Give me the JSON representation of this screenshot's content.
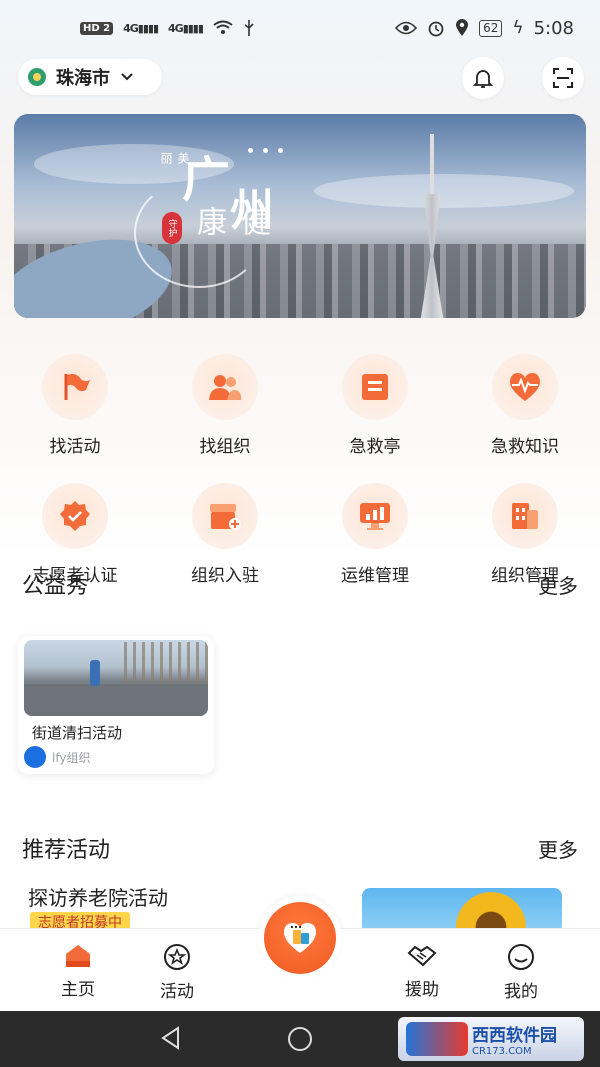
{
  "status_bar": {
    "hd_badge": "HD 2",
    "signal_1": "4G",
    "signal_2": "4G",
    "battery": "62",
    "time": "5:08"
  },
  "header": {
    "city": "珠海市"
  },
  "banner": {
    "small_text": "美丽",
    "title_char_1": "广",
    "title_char_2": "州",
    "subtitle": "健康",
    "seal": "守护"
  },
  "quick_menu": [
    {
      "label": "找活动",
      "icon": "flag-icon"
    },
    {
      "label": "找组织",
      "icon": "group-icon"
    },
    {
      "label": "急救亭",
      "icon": "kiosk-icon"
    },
    {
      "label": "急救知识",
      "icon": "heartbeat-icon"
    },
    {
      "label": "志愿者认证",
      "icon": "certified-badge-icon"
    },
    {
      "label": "组织入驻",
      "icon": "storefront-add-icon"
    },
    {
      "label": "运维管理",
      "icon": "monitor-chart-icon"
    },
    {
      "label": "组织管理",
      "icon": "building-icon"
    }
  ],
  "showcase": {
    "title": "公益秀",
    "more": "更多",
    "card": {
      "title": "街道清扫活动",
      "org": "lfy组织"
    }
  },
  "recommended": {
    "title": "推荐活动",
    "more": "更多",
    "item": {
      "title": "探访养老院活动",
      "tag": "志愿者招募中"
    }
  },
  "tabbar": {
    "home": "主页",
    "activity": "活动",
    "help": "援助",
    "mine": "我的"
  },
  "watermark": {
    "brand": "西西软件园",
    "url": "CR173.COM"
  },
  "colors": {
    "accent": "#f15a22",
    "icon_bg": "#fdeee5",
    "tag_bg": "#ffd54a"
  }
}
